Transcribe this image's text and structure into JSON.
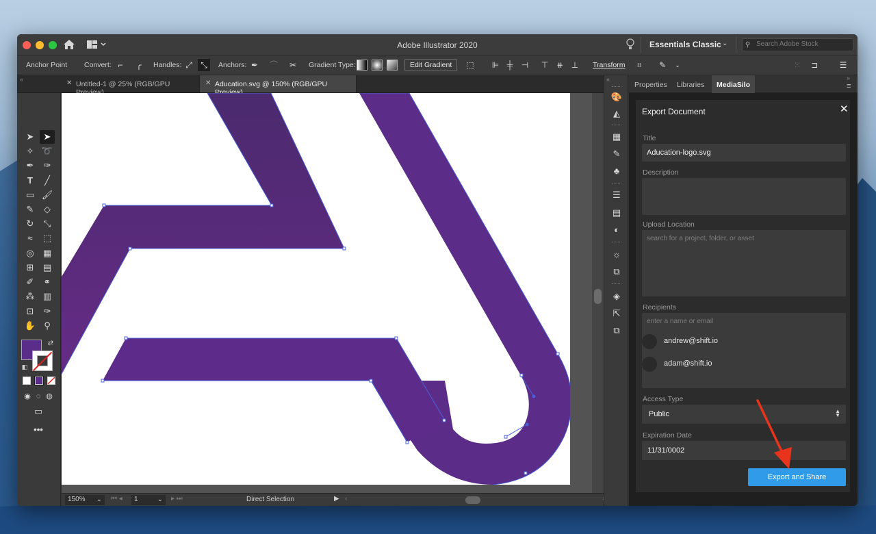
{
  "app": {
    "title": "Adobe Illustrator 2020",
    "workspace": "Essentials Classic",
    "stock_search_placeholder": "Search Adobe Stock"
  },
  "controlbar": {
    "anchor_point": "Anchor Point",
    "convert": "Convert:",
    "handles": "Handles:",
    "anchors": "Anchors:",
    "gradient_type": "Gradient Type:",
    "edit_gradient": "Edit Gradient",
    "transform": "Transform"
  },
  "tabs": [
    {
      "label": "Untitled-1 @ 25% (RGB/GPU Preview)",
      "active": false
    },
    {
      "label": "Aducation.svg @ 150% (RGB/GPU Preview)",
      "active": true
    }
  ],
  "statusbar": {
    "zoom": "150%",
    "page": "1",
    "tool": "Direct Selection"
  },
  "artwork": {
    "fill_color": "#5b2d8a",
    "fill_color_light": "#652b86",
    "selection_color": "#4a5fd8"
  },
  "panel": {
    "tabs": [
      "Properties",
      "Libraries",
      "MediaSilo"
    ],
    "active_tab": "MediaSilo",
    "export": {
      "title": "Export Document",
      "title_label": "Title",
      "title_value": "Aducation-logo.svg",
      "description_label": "Description",
      "upload_label": "Upload Location",
      "upload_placeholder": "search for a project, folder, or asset",
      "recipients_label": "Recipients",
      "recipients_placeholder": "enter a name or email",
      "recipients": [
        "andrew@shift.io",
        "adam@shift.io"
      ],
      "access_label": "Access Type",
      "access_value": "Public",
      "expiration_label": "Expiration Date",
      "expiration_value": "11/31/0002",
      "export_button": "Export and Share"
    }
  },
  "accent": "#2f9be9"
}
